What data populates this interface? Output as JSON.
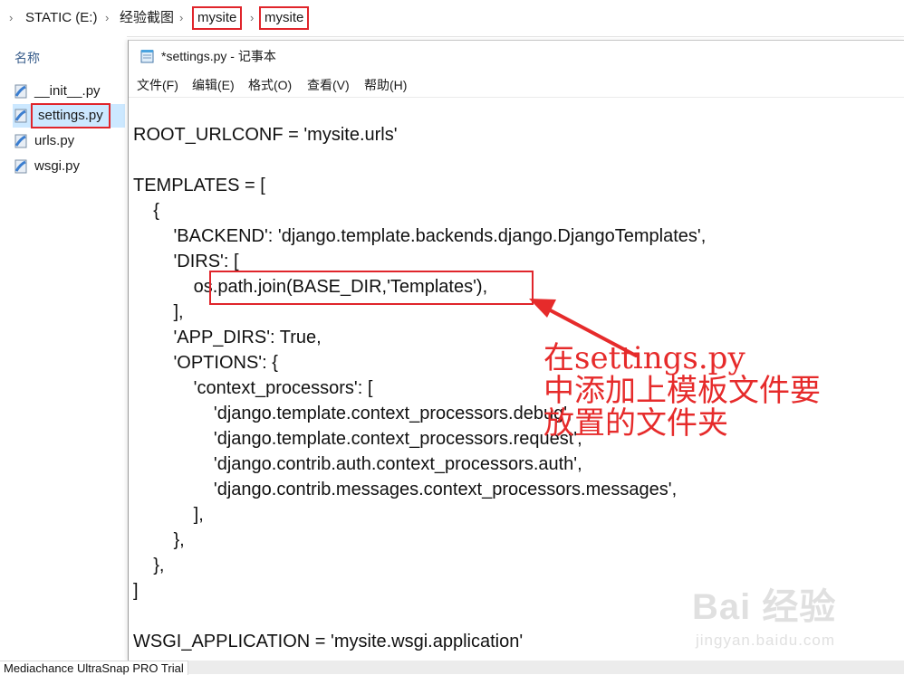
{
  "address_bar": {
    "items": [
      "STATIC (E:)",
      "经验截图",
      "mysite",
      "mysite"
    ],
    "separator": "›",
    "lead_chevron": "›"
  },
  "file_list": {
    "column_header": "名称",
    "items": [
      {
        "name": "__init__.py",
        "selected": false
      },
      {
        "name": "settings.py",
        "selected": true
      },
      {
        "name": "urls.py",
        "selected": false
      },
      {
        "name": "wsgi.py",
        "selected": false
      }
    ]
  },
  "notepad": {
    "title": "*settings.py - 记事本",
    "menu": [
      "文件(F)",
      "编辑(E)",
      "格式(O)",
      "查看(V)",
      "帮助(H)"
    ],
    "code_lines": [
      "ROOT_URLCONF = 'mysite.urls'",
      "TEMPLATES = [",
      "    {",
      "        'BACKEND': 'django.template.backends.django.DjangoTemplates',",
      "        'DIRS': [",
      "            os.path.join(BASE_DIR,'Templates'),",
      "        ],",
      "        'APP_DIRS': True,",
      "        'OPTIONS': {",
      "            'context_processors': [",
      "                'django.template.context_processors.debug',",
      "                'django.template.context_processors.request',",
      "                'django.contrib.auth.context_processors.auth',",
      "                'django.contrib.messages.context_processors.messages',",
      "            ],",
      "        },",
      "    },",
      "]",
      "WSGI_APPLICATION = 'mysite.wsgi.application'"
    ]
  },
  "annotation": {
    "text": "在settings.py\n中添加上模板文件要\n放置的文件夹",
    "color": "#e62b2b"
  },
  "watermark": {
    "main": "Bai 经验",
    "sub": "jingyan.baidu.com"
  },
  "trial_banner": "Mediachance UltraSnap PRO Trial",
  "colors": {
    "highlight_box": "#e0252b",
    "selection": "#cce8ff"
  }
}
